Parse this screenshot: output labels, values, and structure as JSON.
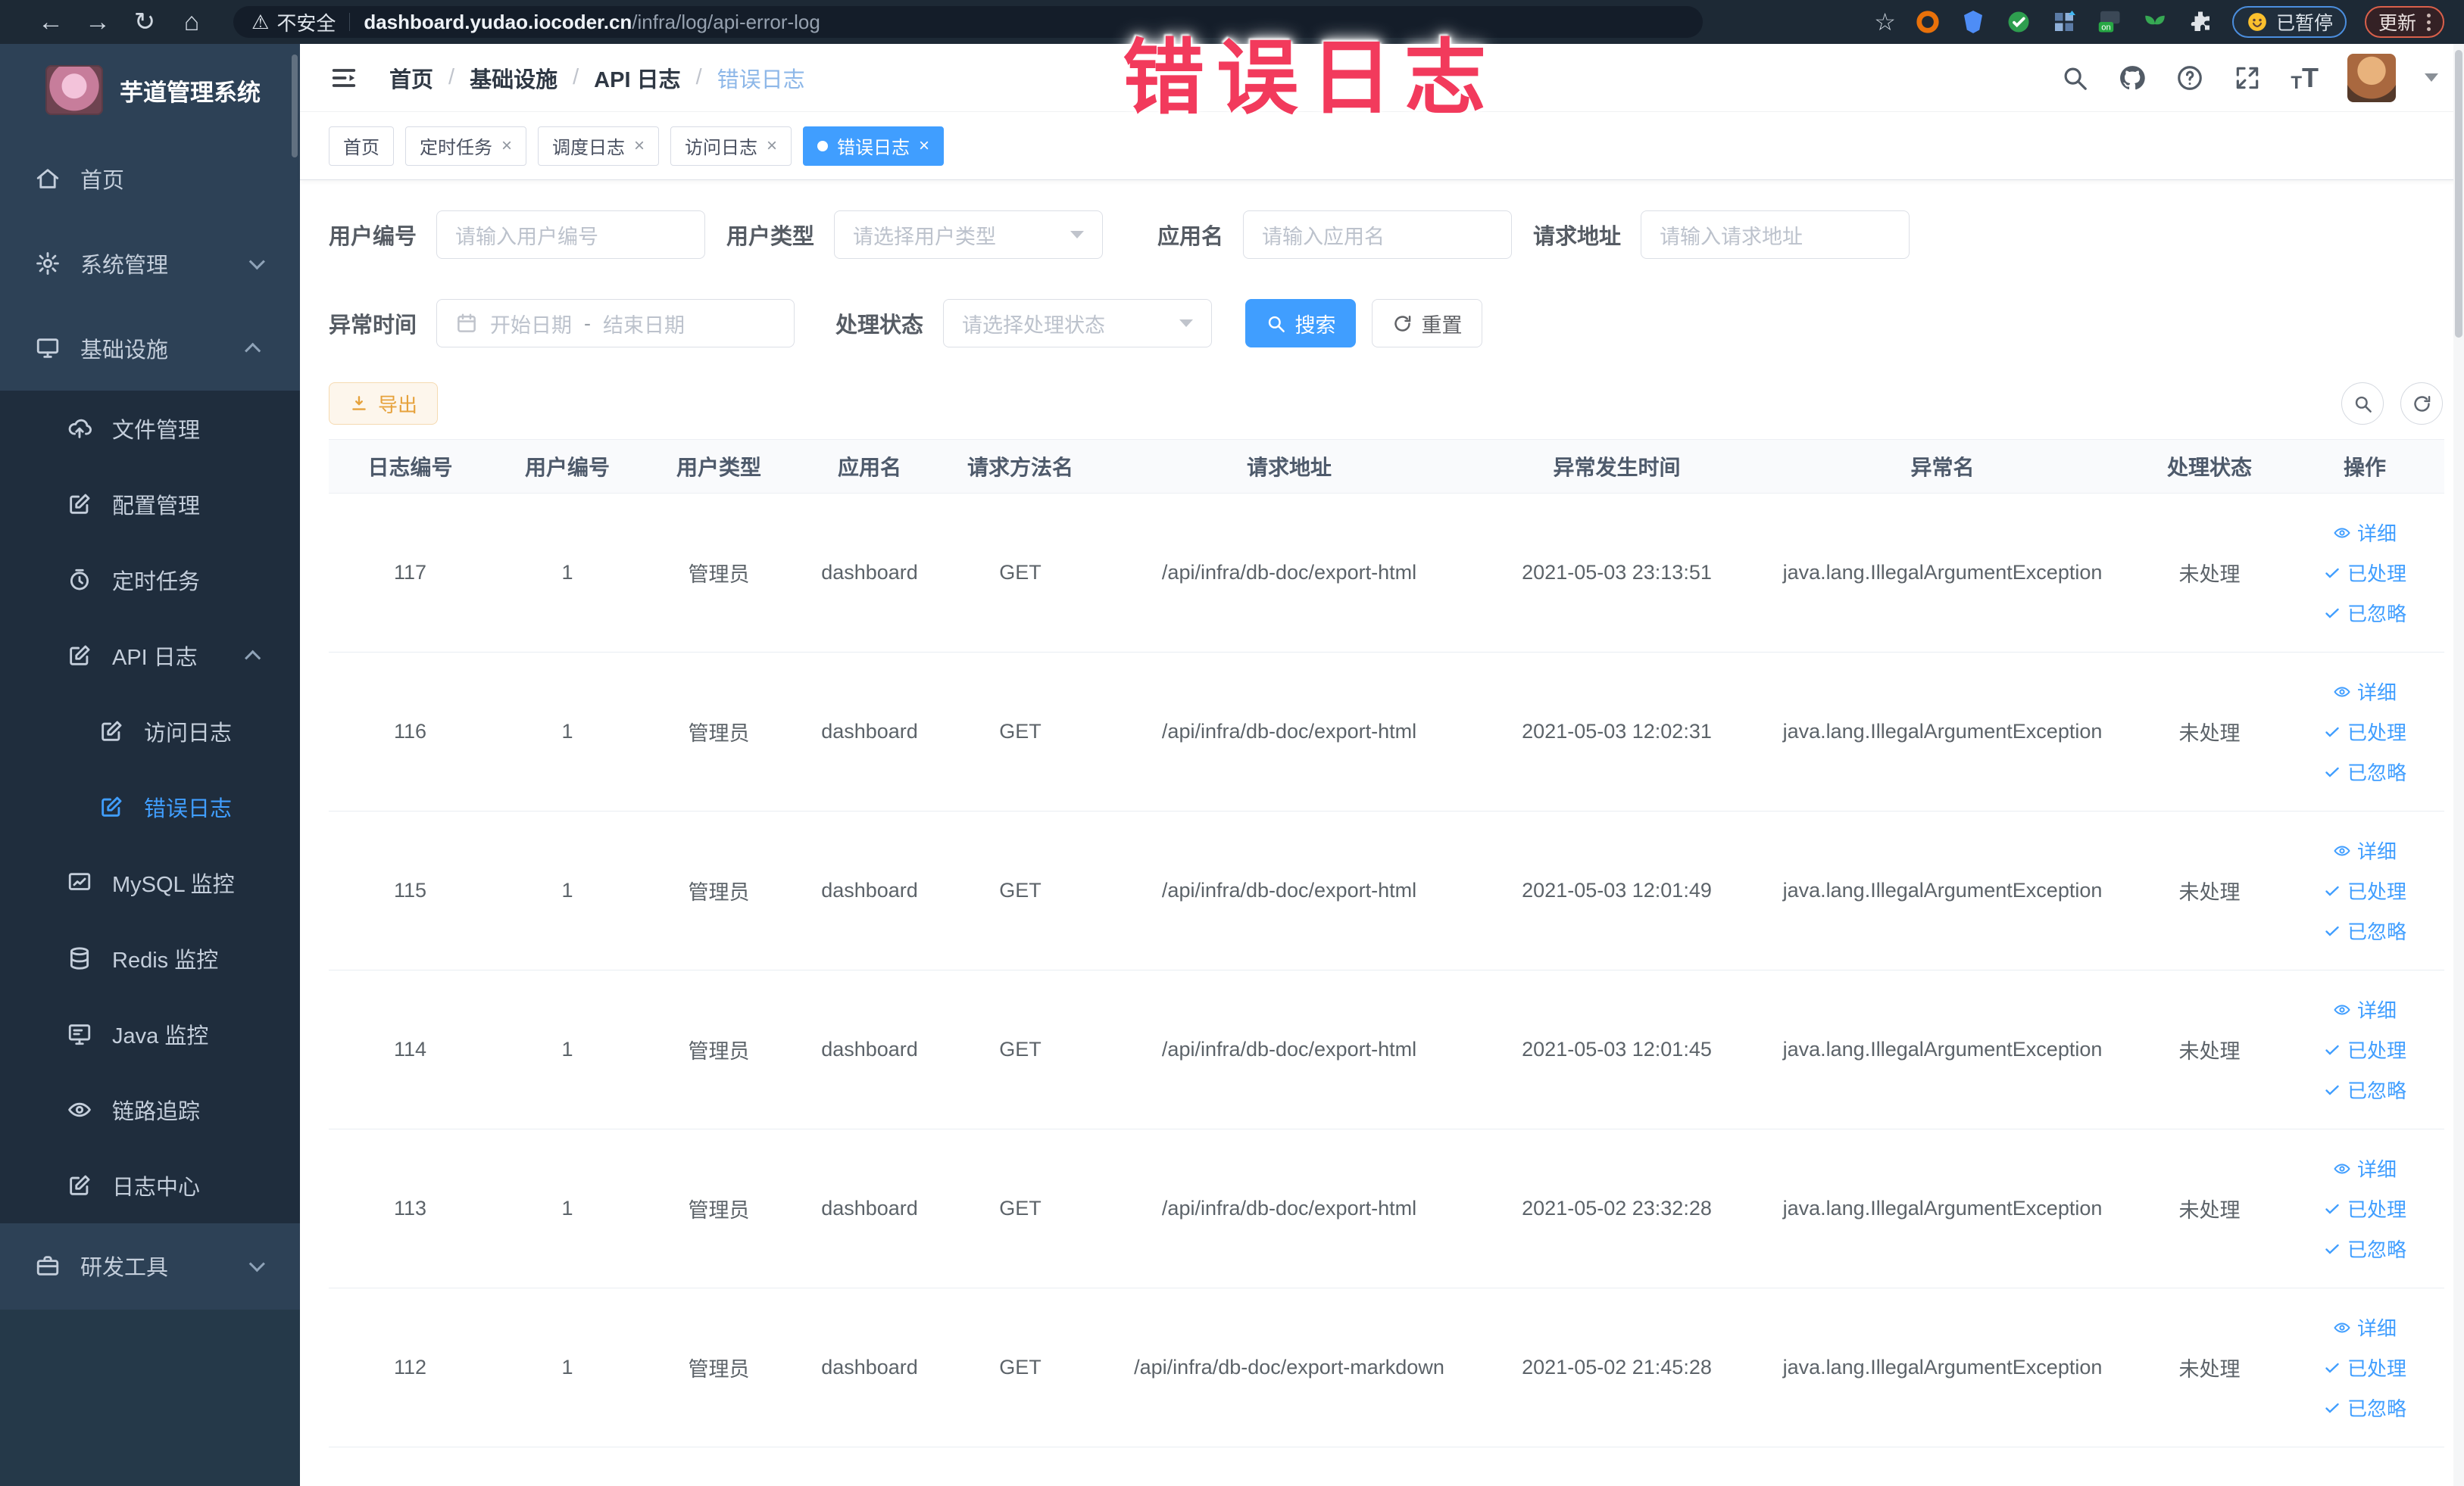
{
  "browser": {
    "security_label": "不安全",
    "url_host": "dashboard.yudao.iocoder.cn",
    "url_path": "/infra/log/api-error-log",
    "profile_chip_label": "已暂停",
    "update_label": "更新"
  },
  "ui": {
    "icons": {
      "back": "←",
      "forward": "→",
      "reload": "↻",
      "home": "⌂",
      "warning": "⚠",
      "star": "☆"
    },
    "close_glyph": "×"
  },
  "annotation": {
    "text": "错误日志",
    "color": "#f23a5c"
  },
  "sidebar": {
    "logo_title": "芋道管理系统",
    "items": [
      {
        "label": "首页",
        "icon": "home-icon"
      },
      {
        "label": "系统管理",
        "icon": "gear-icon",
        "chevron": "down"
      },
      {
        "label": "基础设施",
        "icon": "monitor-icon",
        "chevron": "up"
      },
      {
        "label": "文件管理",
        "icon": "upload-cloud-icon"
      },
      {
        "label": "配置管理",
        "icon": "edit-square-icon"
      },
      {
        "label": "定时任务",
        "icon": "timer-icon"
      },
      {
        "label": "API 日志",
        "icon": "log-edit-icon",
        "chevron": "up"
      },
      {
        "label": "访问日志",
        "icon": "log-edit-icon"
      },
      {
        "label": "错误日志",
        "icon": "log-edit-icon",
        "active": true
      },
      {
        "label": "MySQL 监控",
        "icon": "chart-icon"
      },
      {
        "label": "Redis 监控",
        "icon": "database-icon"
      },
      {
        "label": "Java 监控",
        "icon": "java-monitor-icon"
      },
      {
        "label": "链路追踪",
        "icon": "eye-icon"
      },
      {
        "label": "日志中心",
        "icon": "log-edit-icon"
      },
      {
        "label": "研发工具",
        "icon": "toolbox-icon",
        "chevron": "down"
      }
    ]
  },
  "header": {
    "breadcrumb": [
      "首页",
      "基础设施",
      "API 日志",
      "错误日志"
    ],
    "breadcrumb_separator": "/"
  },
  "tabs": [
    {
      "label": "首页",
      "closable": false
    },
    {
      "label": "定时任务",
      "closable": true
    },
    {
      "label": "调度日志",
      "closable": true
    },
    {
      "label": "访问日志",
      "closable": true
    },
    {
      "label": "错误日志",
      "closable": true,
      "active": true
    }
  ],
  "filters": {
    "user_id": {
      "label": "用户编号",
      "placeholder": "请输入用户编号"
    },
    "user_type": {
      "label": "用户类型",
      "placeholder": "请选择用户类型"
    },
    "app_name": {
      "label": "应用名",
      "placeholder": "请输入应用名"
    },
    "request_url": {
      "label": "请求地址",
      "placeholder": "请输入请求地址"
    },
    "exception_time": {
      "label": "异常时间",
      "start_placeholder": "开始日期",
      "separator": "-",
      "end_placeholder": "结束日期"
    },
    "process_status": {
      "label": "处理状态",
      "placeholder": "请选择处理状态"
    },
    "search_label": "搜索",
    "reset_label": "重置"
  },
  "toolbar": {
    "export_label": "导出"
  },
  "table": {
    "columns": [
      "日志编号",
      "用户编号",
      "用户类型",
      "应用名",
      "请求方法名",
      "请求地址",
      "异常发生时间",
      "异常名",
      "处理状态",
      "操作"
    ],
    "action_labels": {
      "detail": "详细",
      "processed": "已处理",
      "ignored": "已忽略"
    },
    "rows": [
      {
        "id": "117",
        "user_id": "1",
        "user_type": "管理员",
        "app": "dashboard",
        "method": "GET",
        "url": "/api/infra/db-doc/export-html",
        "time": "2021-05-03 23:13:51",
        "exception": "java.lang.IllegalArgumentException",
        "status": "未处理"
      },
      {
        "id": "116",
        "user_id": "1",
        "user_type": "管理员",
        "app": "dashboard",
        "method": "GET",
        "url": "/api/infra/db-doc/export-html",
        "time": "2021-05-03 12:02:31",
        "exception": "java.lang.IllegalArgumentException",
        "status": "未处理"
      },
      {
        "id": "115",
        "user_id": "1",
        "user_type": "管理员",
        "app": "dashboard",
        "method": "GET",
        "url": "/api/infra/db-doc/export-html",
        "time": "2021-05-03 12:01:49",
        "exception": "java.lang.IllegalArgumentException",
        "status": "未处理"
      },
      {
        "id": "114",
        "user_id": "1",
        "user_type": "管理员",
        "app": "dashboard",
        "method": "GET",
        "url": "/api/infra/db-doc/export-html",
        "time": "2021-05-03 12:01:45",
        "exception": "java.lang.IllegalArgumentException",
        "status": "未处理"
      },
      {
        "id": "113",
        "user_id": "1",
        "user_type": "管理员",
        "app": "dashboard",
        "method": "GET",
        "url": "/api/infra/db-doc/export-html",
        "time": "2021-05-02 23:32:28",
        "exception": "java.lang.IllegalArgumentException",
        "status": "未处理"
      },
      {
        "id": "112",
        "user_id": "1",
        "user_type": "管理员",
        "app": "dashboard",
        "method": "GET",
        "url": "/api/infra/db-doc/export-markdown",
        "time": "2021-05-02 21:45:28",
        "exception": "java.lang.IllegalArgumentException",
        "status": "未处理"
      }
    ]
  },
  "colors": {
    "primary": "#409eff",
    "warning": "#e6a23c",
    "annotation": "#f23a5c",
    "sidebar_bg": "#2d4156",
    "submenu_bg": "#1f2d3d"
  }
}
